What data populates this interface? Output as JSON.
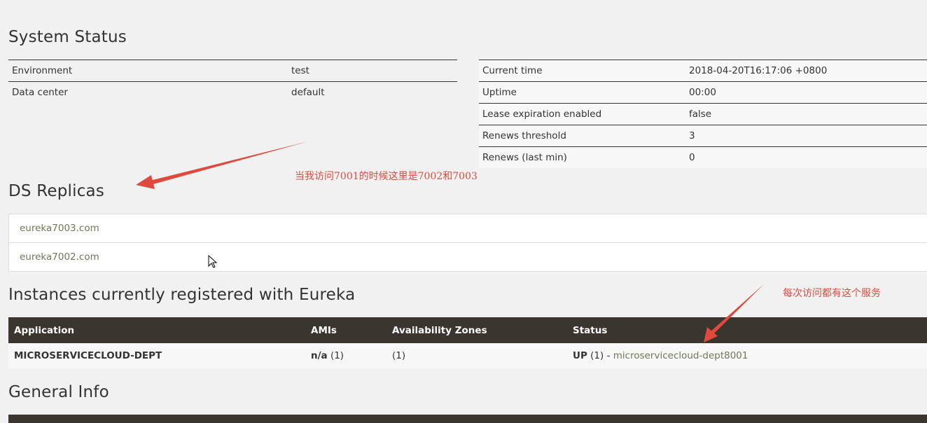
{
  "system_status": {
    "title": "System Status",
    "left_rows": [
      {
        "key": "Environment",
        "value": "test"
      },
      {
        "key": "Data center",
        "value": "default"
      }
    ],
    "right_rows": [
      {
        "key": "Current time",
        "value": "2018-04-20T16:17:06 +0800"
      },
      {
        "key": "Uptime",
        "value": "00:00"
      },
      {
        "key": "Lease expiration enabled",
        "value": "false"
      },
      {
        "key": "Renews threshold",
        "value": "3"
      },
      {
        "key": "Renews (last min)",
        "value": "0"
      }
    ]
  },
  "ds_replicas": {
    "title": "DS Replicas",
    "items": [
      "eureka7003.com",
      "eureka7002.com"
    ]
  },
  "instances": {
    "title": "Instances currently registered with Eureka",
    "headers": [
      "Application",
      "AMIs",
      "Availability Zones",
      "Status"
    ],
    "row": {
      "application": "MICROSERVICECLOUD-DEPT",
      "amis_value": "n/a",
      "amis_count": "(1)",
      "zones": "(1)",
      "status_value": "UP",
      "status_count": "(1) -",
      "status_link": "microservicecloud-dept8001"
    }
  },
  "general_info": {
    "title": "General Info"
  },
  "annotations": {
    "note_1": "当我访问7001的时候这里是7002和7003",
    "note_2": "每次访问都有这个服务",
    "color": "#e04a3c"
  },
  "colors": {
    "header_bg": "#3a352e",
    "link": "#6b7a55",
    "page_bg": "#f1f1f1"
  }
}
